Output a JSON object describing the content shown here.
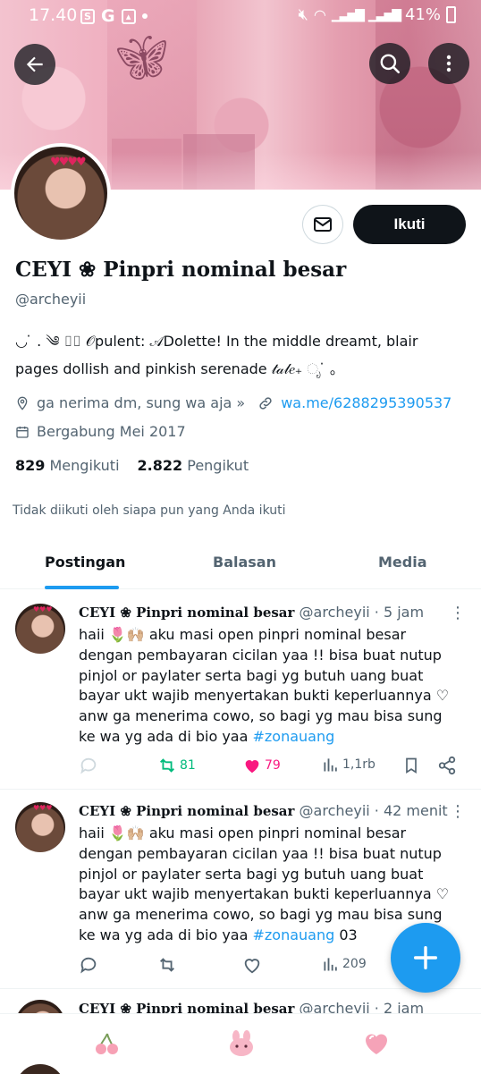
{
  "status_bar": {
    "time": "17.40",
    "battery": "41%"
  },
  "profile": {
    "name": "CEYI ❀ Pinpri nominal besar",
    "handle": "@archeyii",
    "follow_label": "Ikuti",
    "bio_line1": "◡ ̇ . ༄ ⌷⌷ 𝒪pulent: 𝒜Dolette!       In the middle dreamt, blair",
    "bio_line2": "pages  dollish and pinkish serenade 𝓉𝒶𝓁𝑒₊ ೃ ̇   ｡",
    "location": "ga nerima dm, sung wa aja »",
    "link": "wa.me/6288295390537",
    "joined": "Bergabung Mei 2017",
    "following_count": "829",
    "following_label": "Mengikuti",
    "followers_count": "2.822",
    "followers_label": "Pengikut",
    "notice": "Tidak diikuti oleh siapa pun yang Anda ikuti"
  },
  "tabs": [
    {
      "label": "Postingan",
      "active": true
    },
    {
      "label": "Balasan",
      "active": false
    },
    {
      "label": "Media",
      "active": false
    }
  ],
  "tweets": [
    {
      "name": "CEYI ❀ Pinpri nominal besar",
      "meta": "@archeyii · 5 jam",
      "text": "haii 🌷🙌🏼 aku masi open pinpri nominal besar dengan pembayaran cicilan yaa !! bisa buat nutup pinjol or paylater serta bagi yg butuh uang buat bayar ukt wajib menyertakan bukti keperluannya ♡ anw ga menerima cowo, so bagi yg mau bisa sung ke wa yg ada di bio yaa",
      "hashtag": "#zonauang",
      "suffix": "",
      "retweets": "81",
      "likes": "79",
      "views": "1,1rb",
      "retweet_color": "#00ba7c",
      "like_color": "#f91880"
    },
    {
      "name": "CEYI ❀ Pinpri nominal besar",
      "meta": "@archeyii · 42 menit",
      "text": "haii 🌷🙌🏼 aku masi open pinpri nominal besar dengan pembayaran cicilan yaa !! bisa buat nutup pinjol or paylater serta bagi yg butuh uang buat bayar ukt wajib menyertakan bukti keperluannya ♡ anw ga menerima cowo, so bagi yg mau bisa sung ke wa yg ada di bio yaa",
      "hashtag": "#zonauang",
      "suffix": " 03",
      "retweets": "",
      "likes": "",
      "views": "209"
    },
    {
      "name": "CEYI ❀ Pinpri nominal besar",
      "meta": "@archeyii · 2 jam"
    }
  ],
  "colors": {
    "accent": "#1d9bf0",
    "text": "#0f1419",
    "muted": "#536471"
  }
}
